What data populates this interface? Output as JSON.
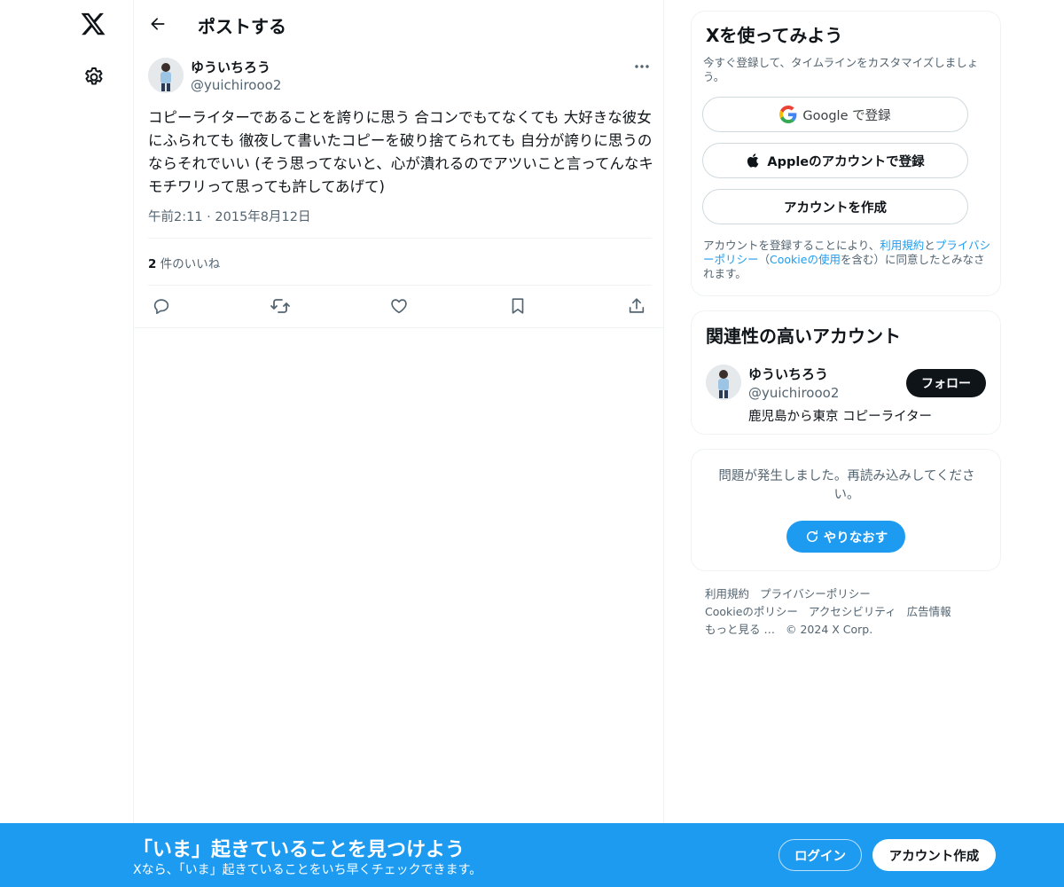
{
  "colors": {
    "accent": "#1d9bf0",
    "text": "#0f1419",
    "secondary": "#536471",
    "border": "#eff3f4",
    "follow_bg": "#0f1419"
  },
  "nav": {
    "logo_icon": "x-logo-icon",
    "settings_icon": "gear-icon"
  },
  "header": {
    "title": "ポストする",
    "back_icon": "arrow-left-icon"
  },
  "tweet": {
    "author_name": "ゆういちろう",
    "author_handle": "@yuichirooo2",
    "text": "コピーライターであることを誇りに思う 合コンでもてなくても 大好きな彼女にふられても 徹夜して書いたコピーを破り捨てられても 自分が誇りに思うのならそれでいい (そう思ってないと、心が潰れるのでアツいこと言ってんなキモチワリって思っても許してあげて)",
    "timestamp": "午前2:11 · 2015年8月12日",
    "likes_count": "2",
    "likes_label": "件のいいね",
    "actions": [
      "reply-icon",
      "retweet-icon",
      "like-icon",
      "bookmark-icon",
      "share-icon"
    ]
  },
  "signup_card": {
    "title": "Xを使ってみよう",
    "subtitle": "今すぐ登録して、タイムラインをカスタマイズしましょう。",
    "google_label": "Google で登録",
    "apple_label": "Appleのアカウントで登録",
    "create_label": "アカウントを作成",
    "legal_1": "アカウントを登録することにより、",
    "legal_terms": "利用規約",
    "legal_2": "と",
    "legal_privacy": "プライバシーポリシー",
    "legal_3": "（",
    "legal_cookie": "Cookieの使用",
    "legal_4": "を含む）に同意したとみなされます。"
  },
  "related_card": {
    "title": "関連性の高いアカウント",
    "name": "ゆういちろう",
    "handle": "@yuichirooo2",
    "bio": "鹿児島から東京 コピーライター",
    "follow_label": "フォロー"
  },
  "error_card": {
    "message": "問題が発生しました。再読み込みしてください。",
    "retry_label": "やりなおす"
  },
  "footer": {
    "terms": "利用規約",
    "privacy": "プライバシーポリシー",
    "cookie": "Cookieのポリシー",
    "accessibility": "アクセシビリティ",
    "ads": "広告情報",
    "more": "もっと見る …",
    "copyright": "© 2024 X Corp."
  },
  "bottom_bar": {
    "title": "「いま」起きていることを見つけよう",
    "subtitle": "Xなら、「いま」起きていることをいち早くチェックできます。",
    "login_label": "ログイン",
    "signup_label": "アカウント作成"
  }
}
